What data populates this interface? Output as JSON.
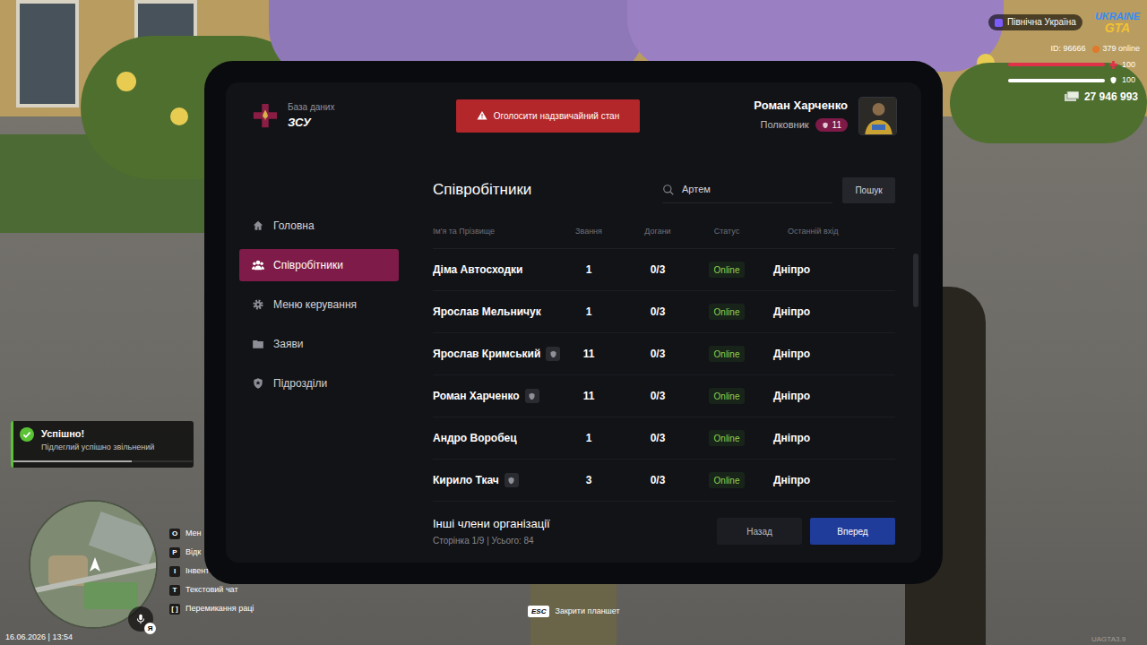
{
  "hud": {
    "server": "Північна Україна",
    "logo": {
      "top": "UKRAINE",
      "bottom": "GTA"
    },
    "player_id": "ID: 96666",
    "online": "379 online",
    "health": {
      "reading": "100",
      "level": 1
    },
    "armor": {
      "reading": "100",
      "level": 1
    },
    "money": "27 946 993"
  },
  "notification": {
    "title": "Успішно!",
    "message": "Підлеглий успішно звільнений",
    "level": 0.66
  },
  "key_hints": [
    {
      "key": "O",
      "label": "Мен"
    },
    {
      "key": "P",
      "label": "Відк"
    },
    {
      "key": "I",
      "label": "Інвент"
    },
    {
      "key": "T",
      "label": "Текстовий чат"
    },
    {
      "key": "[ ]",
      "label": "Перемикання раці"
    }
  ],
  "datetime": "16.06.2026 | 13:54",
  "voice": {
    "badge": "Я"
  },
  "close_hint": {
    "key": "ESC",
    "label": "Закрити планшет"
  },
  "version": "UAGTA3.9",
  "tablet": {
    "brand": {
      "subtitle": "База даних",
      "title": "ЗСУ"
    },
    "emergency_button": "Оголосити надзвичайний стан",
    "user": {
      "name": "Роман Харченко",
      "rank": "Полковник",
      "level": "11"
    },
    "sidebar": {
      "items": [
        {
          "label": "Головна",
          "selected": false
        },
        {
          "label": "Співробітники",
          "selected": true
        },
        {
          "label": "Меню керування",
          "selected": false
        },
        {
          "label": "Заяви",
          "selected": false
        },
        {
          "label": "Підрозділи",
          "selected": false
        }
      ]
    },
    "page": {
      "title": "Співробітники",
      "search": {
        "value": "Артем"
      },
      "search_button": "Пошук"
    },
    "table": {
      "columns": [
        "Ім'я та Прізвище",
        "Звання",
        "Догани",
        "Статус",
        "Останній вхід"
      ],
      "rows": [
        {
          "name": "Діма Автосходки",
          "leader": false,
          "rank": "1",
          "reprimands": "0/3",
          "status": "Online",
          "online": true,
          "last_login": "Дніпро"
        },
        {
          "name": "Ярослав Мельничук",
          "leader": false,
          "rank": "1",
          "reprimands": "0/3",
          "status": "Online",
          "online": true,
          "last_login": "Дніпро"
        },
        {
          "name": "Ярослав Кримський",
          "leader": true,
          "rank": "11",
          "reprimands": "0/3",
          "status": "Online",
          "online": true,
          "last_login": "Дніпро"
        },
        {
          "name": "Роман Харченко",
          "leader": true,
          "rank": "11",
          "reprimands": "0/3",
          "status": "Online",
          "online": true,
          "last_login": "Дніпро"
        },
        {
          "name": "Андро Воробец",
          "leader": false,
          "rank": "1",
          "reprimands": "0/3",
          "status": "Online",
          "online": true,
          "last_login": "Дніпро"
        },
        {
          "name": "Кирило Ткач",
          "leader": true,
          "rank": "3",
          "reprimands": "0/3",
          "status": "Online",
          "online": true,
          "last_login": "Дніпро"
        }
      ]
    },
    "footer": {
      "title": "Інші члени організації",
      "pagination": "Сторінка 1/9 | Усього: 84",
      "buttons": [
        "Назад",
        "Вперед"
      ]
    }
  }
}
